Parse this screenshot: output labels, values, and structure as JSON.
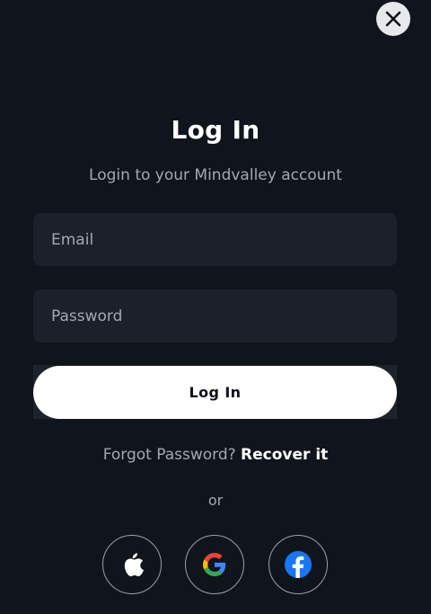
{
  "dialog": {
    "close_icon": "close-icon",
    "title": "Log In",
    "subtitle": "Login to your Mindvalley account"
  },
  "form": {
    "email": {
      "placeholder": "Email",
      "value": ""
    },
    "password": {
      "placeholder": "Password",
      "value": ""
    },
    "submit_label": "Log In"
  },
  "forgot": {
    "prompt": "Forgot Password?",
    "link_label": "Recover it"
  },
  "divider_text": "or",
  "social": {
    "buttons": [
      {
        "icon": "apple-icon"
      },
      {
        "icon": "google-icon"
      },
      {
        "icon": "facebook-icon"
      }
    ]
  },
  "colors": {
    "background": "#10151d",
    "field_bg": "#1c202b",
    "muted_text": "#a4a8b1",
    "primary_button": "#ffffff",
    "facebook": "#1877f2"
  }
}
